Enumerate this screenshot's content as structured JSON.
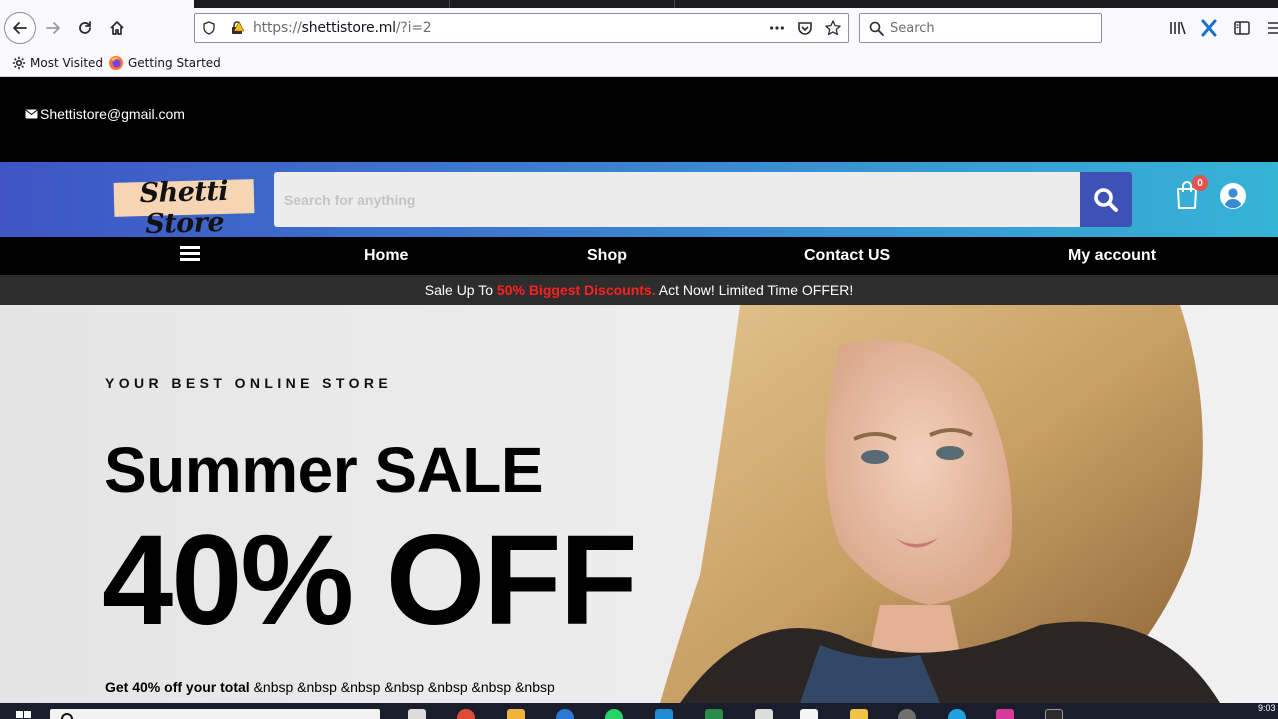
{
  "browser": {
    "url_prefix": "https://",
    "url_domain": "shettistore.ml",
    "url_path": "/?i=2",
    "search_placeholder": "Search",
    "bookmarks": [
      "Most Visited",
      "Getting Started"
    ]
  },
  "topbar": {
    "email": "Shettistore@gmail.com"
  },
  "header": {
    "logo_text": "Shetti Store",
    "search_placeholder": "Search for anything",
    "cart_count": "0"
  },
  "nav": {
    "items": [
      "Home",
      "Shop",
      "Contact US",
      "My account"
    ]
  },
  "promo": {
    "prefix": "Sale Up To ",
    "highlight": "50% Biggest Discounts.",
    "suffix": " Act Now! Limited Time OFFER!"
  },
  "hero": {
    "kicker": "YOUR BEST ONLINE STORE",
    "title": "Summer SALE",
    "discount": "40% OFF",
    "note_bold": "Get 40% off your total",
    "note_rest": " &nbsp &nbsp &nbsp &nbsp &nbsp &nbsp &nbsp"
  },
  "taskbar": {
    "clock": "9:03"
  },
  "colors": {
    "header_gradient_start": "#3f55c5",
    "header_gradient_end": "#35b4d6",
    "search_button": "#3e51b5",
    "promo_highlight": "#ff2020",
    "cart_badge": "#e8524a"
  }
}
